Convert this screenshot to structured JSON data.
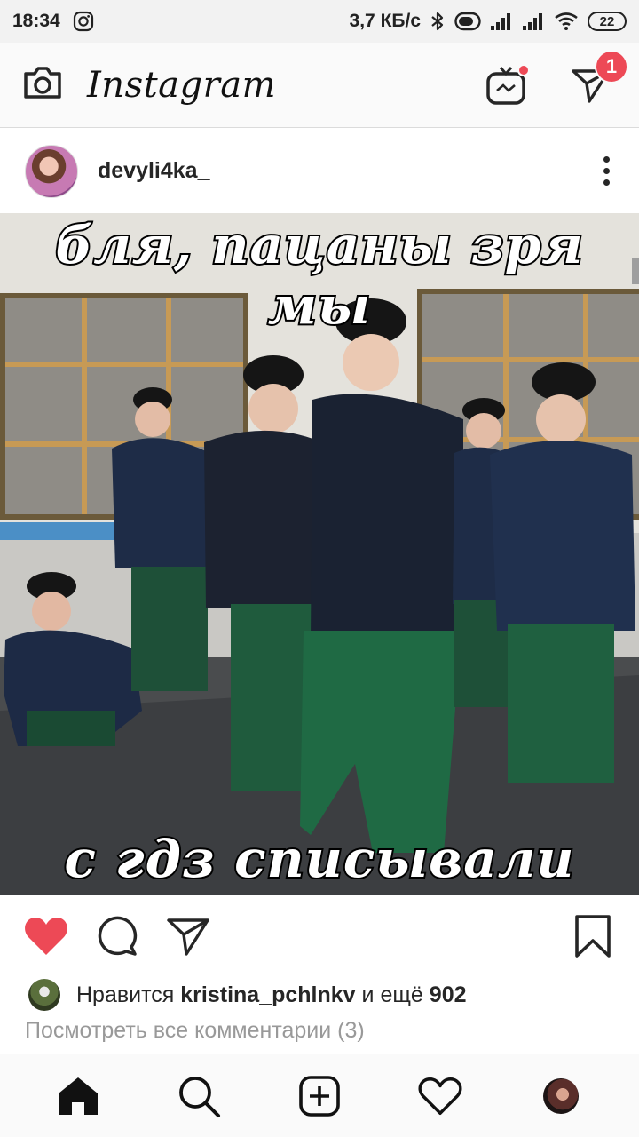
{
  "status_bar": {
    "time": "18:34",
    "network_speed": "3,7 КБ/с",
    "battery_level": "22",
    "icons": [
      "instagram-notification-icon",
      "bluetooth-icon",
      "toggle-icon",
      "signal-icon",
      "signal-icon",
      "wifi-icon",
      "battery-icon"
    ]
  },
  "app_bar": {
    "title": "Instagram",
    "dm_badge_count": "1",
    "icons": [
      "camera-icon",
      "igtv-icon",
      "direct-message-icon"
    ],
    "accent_color": "#ed4956"
  },
  "post": {
    "username": "devyli4ka_",
    "meme_top_text": "бля, пацаны зря мы",
    "meme_bottom_text": "с гдз списывали",
    "liked": true,
    "like_color": "#ed4956",
    "likes": {
      "prefix": "Нравится",
      "liker": "kristina_pchlnkv",
      "middle": "и ещё",
      "count": "902"
    },
    "view_comments": "Посмотреть все комментарии (3)"
  },
  "bottom_nav": {
    "items": [
      "home-icon",
      "search-icon",
      "new-post-icon",
      "activity-icon",
      "profile-avatar"
    ]
  }
}
